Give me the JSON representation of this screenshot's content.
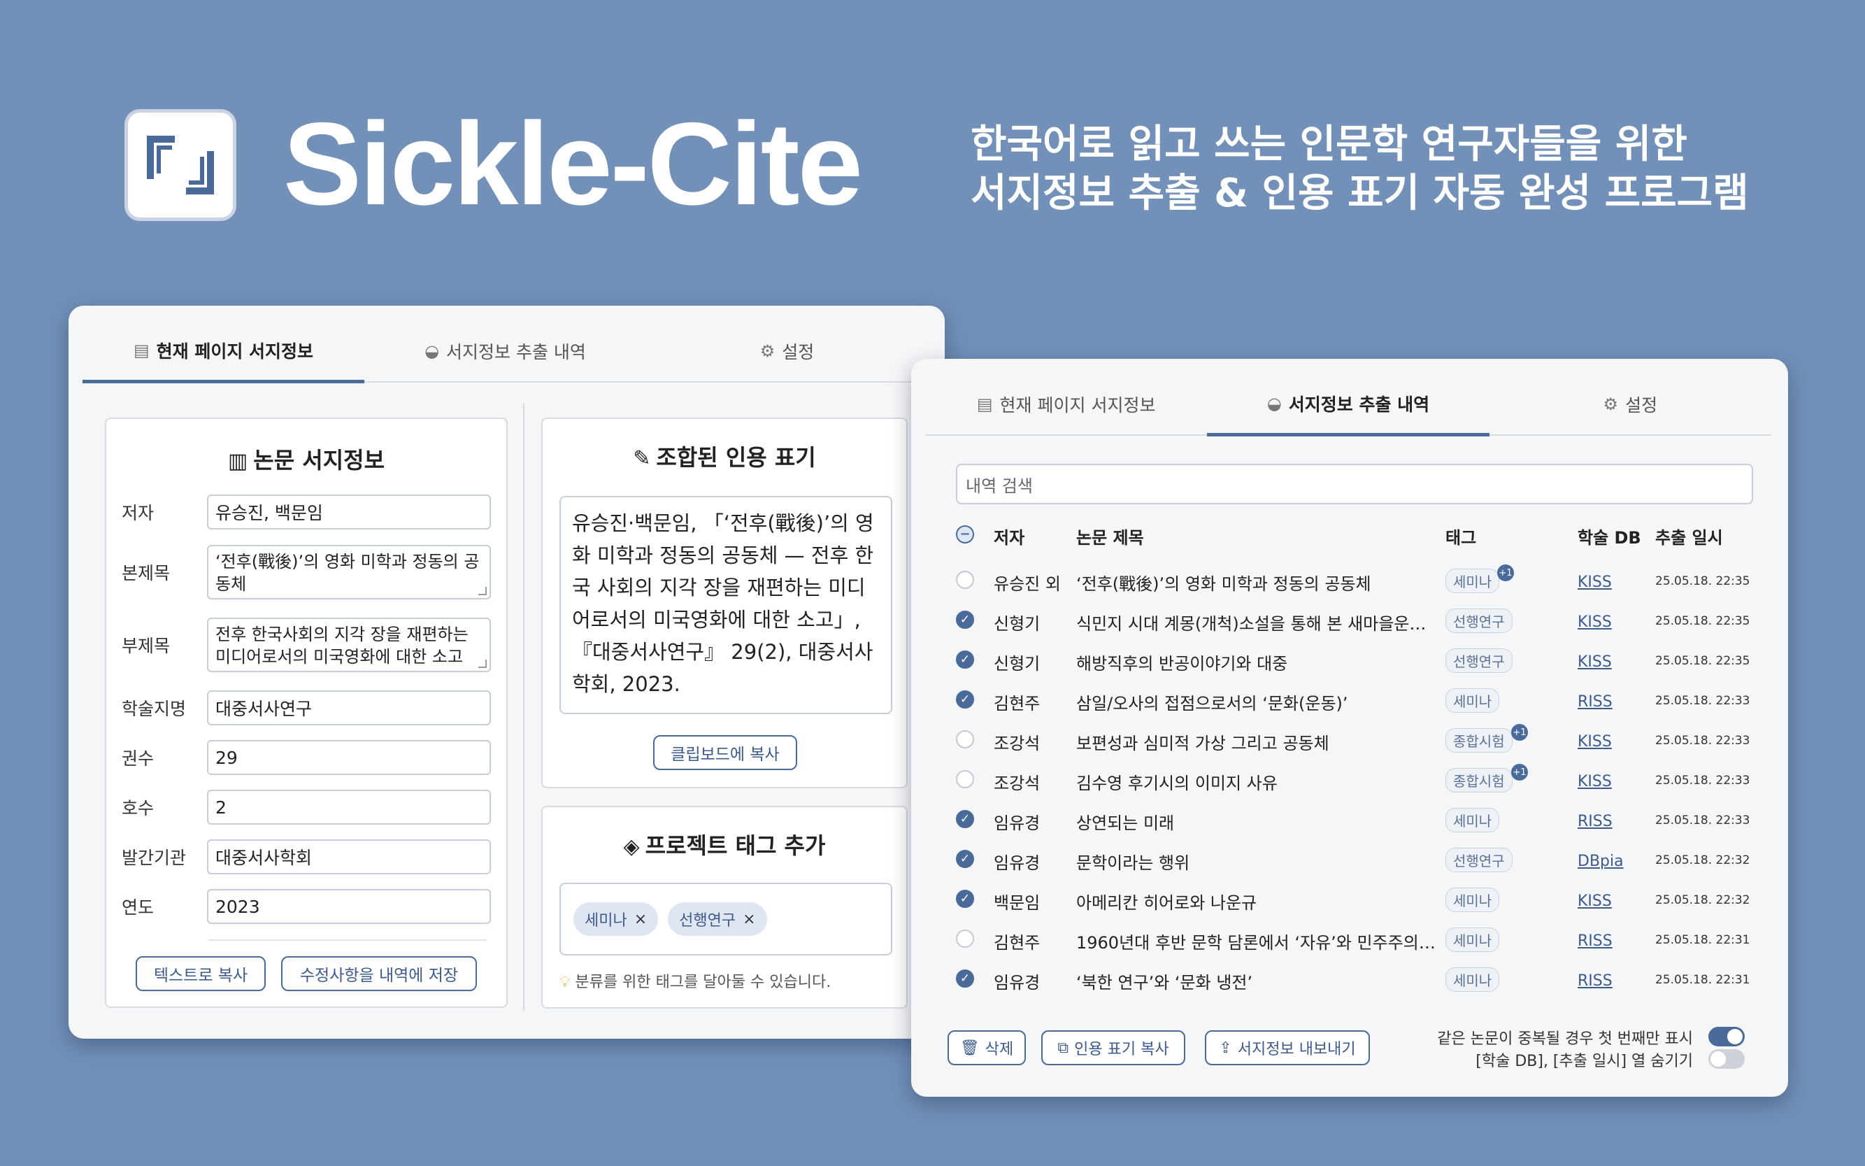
{
  "header": {
    "app_name": "Sickle-Cite",
    "tagline_line1": "한국어로 읽고 쓰는 인문학 연구자들을 위한",
    "tagline_line2": "서지정보 추출 & 인용 표기 자동 완성 프로그램"
  },
  "tabs": [
    "현재 페이지 서지정보",
    "서지정보 추출 내역",
    "설정"
  ],
  "biblio": {
    "title": "논문 서지정보",
    "fields": [
      {
        "label": "저자",
        "value": "유승진, 백문임"
      },
      {
        "label": "본제목",
        "value": "‘전후(戰後)’의 영화 미학과 정동의 공동체"
      },
      {
        "label": "부제목",
        "value": "전후 한국사회의 지각 장을 재편하는 미디어로서의 미국영화에 대한 소고"
      },
      {
        "label": "학술지명",
        "value": "대중서사연구"
      },
      {
        "label": "권수",
        "value": "29"
      },
      {
        "label": "호수",
        "value": "2"
      },
      {
        "label": "발간기관",
        "value": "대중서사학회"
      },
      {
        "label": "연도",
        "value": "2023"
      }
    ],
    "copy_text_btn": "텍스트로 복사",
    "save_btn": "수정사항을 내역에 저장"
  },
  "citation": {
    "title": "조합된 인용 표기",
    "text": "유승진·백문임, 「‘전후(戰後)’의 영화 미학과 정동의 공동체 — 전후 한국 사회의 지각 장을 재편하는 미디어로서의 미국영화에 대한 소고」, 『대중서사연구』 29(2), 대중서사학회, 2023.",
    "copy_btn": "클립보드에 복사"
  },
  "project_tags": {
    "title": "프로젝트 태그 추가",
    "tags": [
      "세미나",
      "선행연구"
    ],
    "hint": "분류를 위한 태그를 달아둘 수 있습니다."
  },
  "history": {
    "search_placeholder": "내역 검색",
    "columns": {
      "author": "저자",
      "title": "논문 제목",
      "tag": "태그",
      "db": "학술 DB",
      "date": "추출 일시"
    },
    "rows": [
      {
        "checked": false,
        "author": "유승진 외",
        "title": "‘전후(戰後)’의 영화 미학과 정동의 공동체",
        "tag": "세미나",
        "extra": "+1",
        "db": "KISS",
        "date": "25.05.18. 22:35"
      },
      {
        "checked": true,
        "author": "신형기",
        "title": "식민지 시대 계몽(개척)소설을 통해 본 새마을운동 …",
        "tag": "선행연구",
        "extra": "",
        "db": "KISS",
        "date": "25.05.18. 22:35"
      },
      {
        "checked": true,
        "author": "신형기",
        "title": "해방직후의 반공이야기와 대중",
        "tag": "선행연구",
        "extra": "",
        "db": "KISS",
        "date": "25.05.18. 22:35"
      },
      {
        "checked": true,
        "author": "김현주",
        "title": "삼일/오사의 접점으로서의 ‘문화(운동)’",
        "tag": "세미나",
        "extra": "",
        "db": "RISS",
        "date": "25.05.18. 22:33"
      },
      {
        "checked": false,
        "author": "조강석",
        "title": "보편성과 심미적 가상 그리고 공동체",
        "tag": "종합시험",
        "extra": "+1",
        "db": "KISS",
        "date": "25.05.18. 22:33"
      },
      {
        "checked": false,
        "author": "조강석",
        "title": "김수영 후기시의 이미지 사유",
        "tag": "종합시험",
        "extra": "+1",
        "db": "KISS",
        "date": "25.05.18. 22:33"
      },
      {
        "checked": true,
        "author": "임유경",
        "title": "상연되는 미래",
        "tag": "세미나",
        "extra": "",
        "db": "RISS",
        "date": "25.05.18. 22:33"
      },
      {
        "checked": true,
        "author": "임유경",
        "title": "문학이라는 행위",
        "tag": "선행연구",
        "extra": "",
        "db": "DBpia",
        "date": "25.05.18. 22:32"
      },
      {
        "checked": true,
        "author": "백문임",
        "title": "아메리칸 히어로와 나운규",
        "tag": "세미나",
        "extra": "",
        "db": "KISS",
        "date": "25.05.18. 22:32"
      },
      {
        "checked": false,
        "author": "김현주",
        "title": "1960년대 후반 문학 담론에서 ‘자유’와 민주주의…",
        "tag": "세미나",
        "extra": "",
        "db": "RISS",
        "date": "25.05.18. 22:31"
      },
      {
        "checked": true,
        "author": "임유경",
        "title": "‘북한 연구’와 ‘문화 냉전’",
        "tag": "세미나",
        "extra": "",
        "db": "RISS",
        "date": "25.05.18. 22:31"
      }
    ],
    "delete_btn": "삭제",
    "copy_cite_btn": "인용 표기 복사",
    "export_btn": "서지정보 내보내기",
    "opt_dedupe": "같은 논문이 중복될 경우 첫 번째만 표시",
    "opt_hide_cols": "[학술 DB], [추출 일시] 열 숨기기"
  }
}
